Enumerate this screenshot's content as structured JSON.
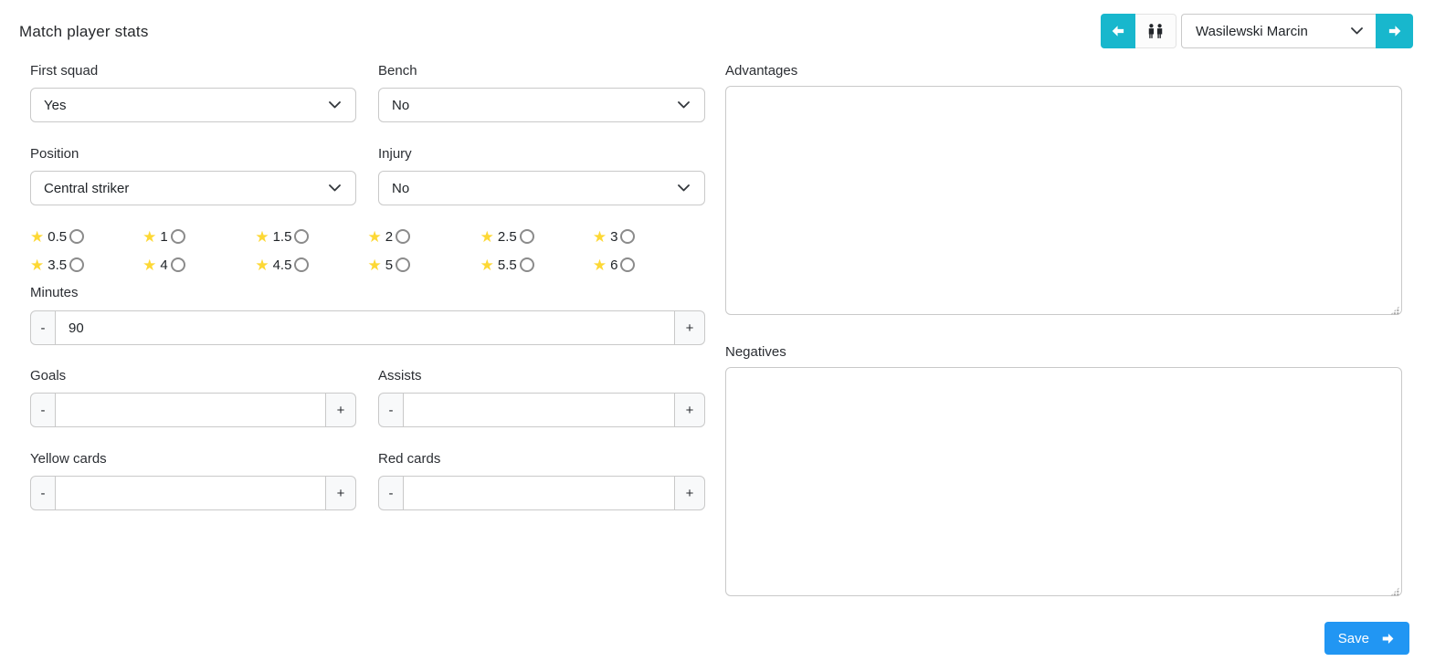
{
  "header": {
    "title": "Match player stats"
  },
  "player_nav": {
    "selected_player": "Wasilewski Marcin",
    "prev_icon": "arrow-left-icon",
    "players_icon": "people-icon",
    "next_icon": "arrow-right-icon"
  },
  "glyphs": {
    "star": "★",
    "minus": "-",
    "plus": "+"
  },
  "form": {
    "first_squad": {
      "label": "First squad",
      "value": "Yes"
    },
    "bench": {
      "label": "Bench",
      "value": "No"
    },
    "position": {
      "label": "Position",
      "value": "Central striker"
    },
    "injury": {
      "label": "Injury",
      "value": "No"
    },
    "rating_options": [
      "0.5",
      "1",
      "1.5",
      "2",
      "2.5",
      "3",
      "3.5",
      "4",
      "4.5",
      "5",
      "5.5",
      "6"
    ],
    "rating_selected": "",
    "minutes": {
      "label": "Minutes",
      "value": "90"
    },
    "goals": {
      "label": "Goals",
      "value": ""
    },
    "assists": {
      "label": "Assists",
      "value": ""
    },
    "yellow_cards": {
      "label": "Yellow cards",
      "value": ""
    },
    "red_cards": {
      "label": "Red cards",
      "value": ""
    },
    "advantages": {
      "label": "Advantages",
      "value": ""
    },
    "negatives": {
      "label": "Negatives",
      "value": ""
    }
  },
  "footer": {
    "save_label": "Save"
  },
  "colors": {
    "accent_cyan": "#18b7cd",
    "accent_blue": "#2196f3",
    "star_yellow": "#fdd835"
  }
}
